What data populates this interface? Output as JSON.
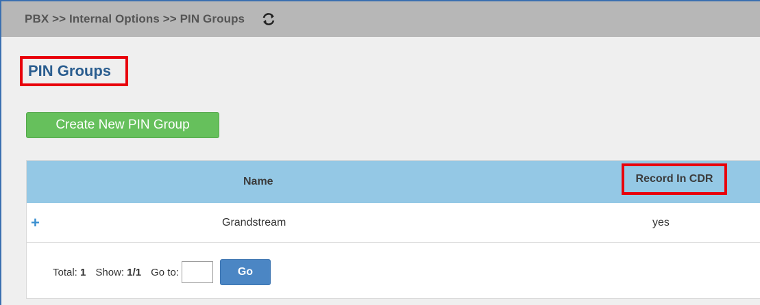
{
  "breadcrumb": "PBX >> Internal Options >> PIN Groups",
  "icons": {
    "refresh": "refresh-icon",
    "expand": "plus-icon"
  },
  "page_title": "PIN Groups",
  "create_button": "Create New PIN Group",
  "table": {
    "columns": [
      "Name",
      "Record In CDR"
    ],
    "rows": [
      {
        "expand": "+",
        "name": "Grandstream",
        "record_in_cdr": "yes"
      }
    ]
  },
  "pager": {
    "total_label": "Total:",
    "total_value": "1",
    "show_label": "Show:",
    "show_value": "1/1",
    "goto_label": "Go to:",
    "goto_value": "",
    "go_button": "Go"
  },
  "colors": {
    "topbar": "#b7b7b7",
    "title": "#2a5d8f",
    "create_button": "#66c05c",
    "table_header": "#94c8e5",
    "go_button": "#4b86c4",
    "highlight": "#e8000b"
  }
}
